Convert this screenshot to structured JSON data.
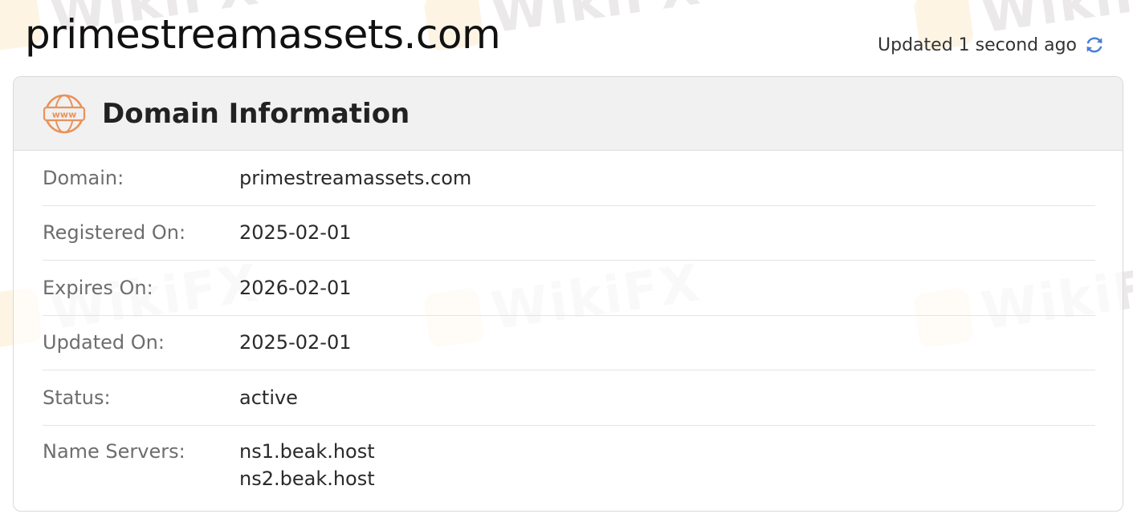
{
  "header": {
    "site_title": "primestreamassets.com",
    "updated_text": "Updated 1 second ago",
    "refresh_icon": "refresh-icon"
  },
  "card": {
    "icon": "www-globe-icon",
    "title": "Domain Information",
    "rows": [
      {
        "label": "Domain:",
        "value": "primestreamassets.com"
      },
      {
        "label": "Registered On:",
        "value": "2025-02-01"
      },
      {
        "label": "Expires On:",
        "value": "2026-02-01"
      },
      {
        "label": "Updated On:",
        "value": "2025-02-01"
      },
      {
        "label": "Status:",
        "value": "active"
      }
    ],
    "name_servers": {
      "label": "Name Servers:",
      "values": [
        "ns1.beak.host",
        "ns2.beak.host"
      ]
    }
  },
  "watermark": {
    "text": "WikiFX"
  },
  "colors": {
    "accent_icon": "#e8925a",
    "refresh_blue": "#4a7fd6",
    "header_bg": "#f0f0f0",
    "border": "#d9d9d9"
  }
}
